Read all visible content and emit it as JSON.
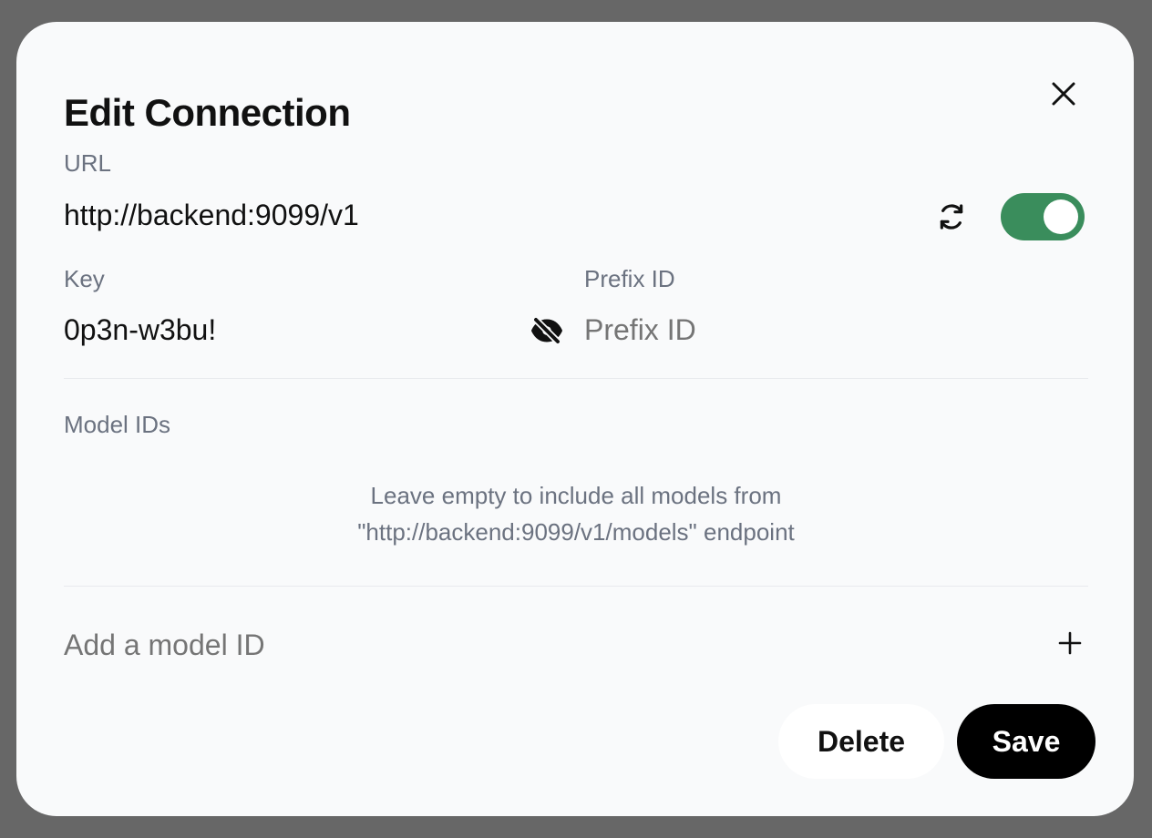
{
  "modal": {
    "title": "Edit Connection"
  },
  "url": {
    "label": "URL",
    "value": "http://backend:9099/v1",
    "enabled": true,
    "toggle_color": "#3a8d5c"
  },
  "key": {
    "label": "Key",
    "value": "0p3n-w3bu!"
  },
  "prefix": {
    "label": "Prefix ID",
    "placeholder": "Prefix ID"
  },
  "models": {
    "label": "Model IDs",
    "info_line1": "Leave empty to include all models from",
    "info_line2": "\"http://backend:9099/v1/models\" endpoint",
    "add_placeholder": "Add a model ID"
  },
  "actions": {
    "delete_label": "Delete",
    "save_label": "Save"
  },
  "icons": {
    "close": "close-icon",
    "refresh": "refresh-icon",
    "visibility": "eye-off-icon",
    "add": "plus-icon"
  }
}
